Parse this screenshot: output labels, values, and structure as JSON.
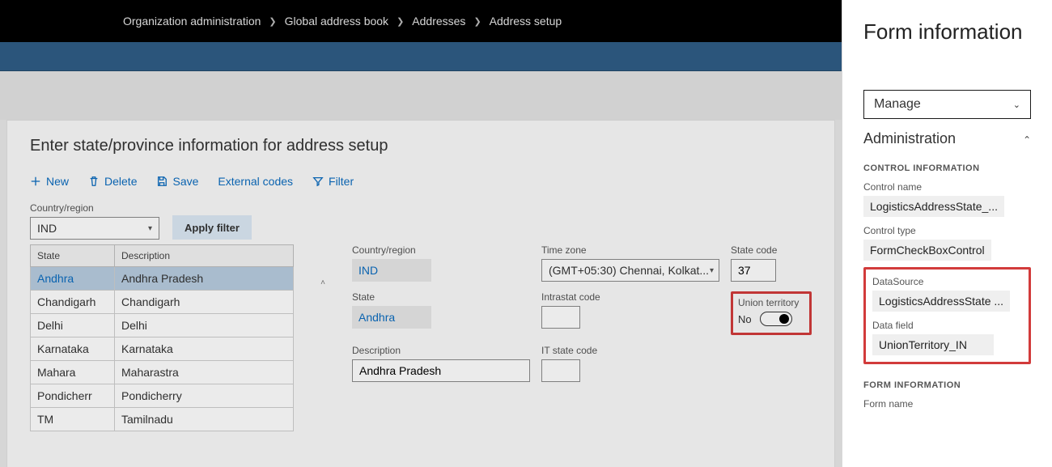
{
  "breadcrumb": [
    "Organization administration",
    "Global address book",
    "Addresses",
    "Address setup"
  ],
  "page": {
    "title": "Enter state/province information for address setup"
  },
  "toolbar": {
    "new": "New",
    "delete": "Delete",
    "save": "Save",
    "external_codes": "External codes",
    "filter": "Filter"
  },
  "filter": {
    "country_label": "Country/region",
    "country_value": "IND",
    "apply_button": "Apply filter"
  },
  "grid": {
    "cols": {
      "state": "State",
      "description": "Description"
    },
    "rows": [
      {
        "state": "Andhra",
        "description": "Andhra Pradesh",
        "selected": true
      },
      {
        "state": "Chandigarh",
        "description": "Chandigarh",
        "selected": false
      },
      {
        "state": "Delhi",
        "description": "Delhi",
        "selected": false
      },
      {
        "state": "Karnataka",
        "description": "Karnataka",
        "selected": false
      },
      {
        "state": "Mahara",
        "description": "Maharastra",
        "selected": false
      },
      {
        "state": "Pondicherr",
        "description": "Pondicherry",
        "selected": false
      },
      {
        "state": "TM",
        "description": "Tamilnadu",
        "selected": false
      }
    ]
  },
  "detail": {
    "country_label": "Country/region",
    "country_value": "IND",
    "timezone_label": "Time zone",
    "timezone_value": "(GMT+05:30) Chennai, Kolkat...",
    "statecode_label": "State code",
    "statecode_value": "37",
    "state_label": "State",
    "state_value": "Andhra",
    "intrastat_label": "Intrastat code",
    "intrastat_value": "",
    "union_label": "Union territory",
    "union_value": "No",
    "description_label": "Description",
    "description_value": "Andhra Pradesh",
    "itstate_label": "IT state code",
    "itstate_value": ""
  },
  "side": {
    "title": "Form information",
    "manage_label": "Manage",
    "admin_label": "Administration",
    "control_info_head": "CONTROL INFORMATION",
    "control_name_label": "Control name",
    "control_name_value": "LogisticsAddressState_...",
    "control_type_label": "Control type",
    "control_type_value": "FormCheckBoxControl",
    "datasource_label": "DataSource",
    "datasource_value": "LogisticsAddressState ...",
    "datafield_label": "Data field",
    "datafield_value": "UnionTerritory_IN",
    "form_info_head": "FORM INFORMATION",
    "form_name_label": "Form name"
  }
}
